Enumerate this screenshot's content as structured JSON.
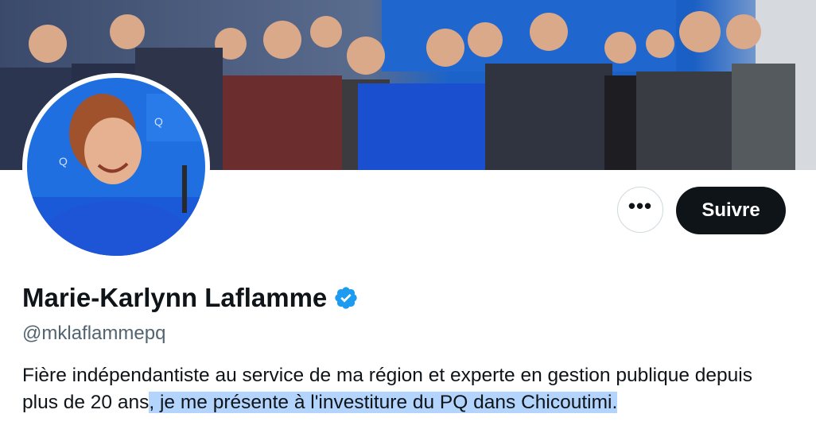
{
  "profile": {
    "name": "Marie-Karlynn Laflamme",
    "handle": "@mklaflammepq",
    "bio_part1": "Fière indépendantiste au service de ma région et experte en gestion publique depuis plus de 20 ans",
    "bio_part2": ", je me présente à l'investiture du PQ dans Chicoutimi.",
    "verified": true,
    "verified_icon": "verified-badge-icon",
    "verified_color": "#1d9bf0"
  },
  "actions": {
    "more_label": "•••",
    "follow_label": "Suivre"
  },
  "colors": {
    "follow_bg": "#0f1419",
    "handle": "#536471",
    "selection": "#b3d4fc"
  }
}
